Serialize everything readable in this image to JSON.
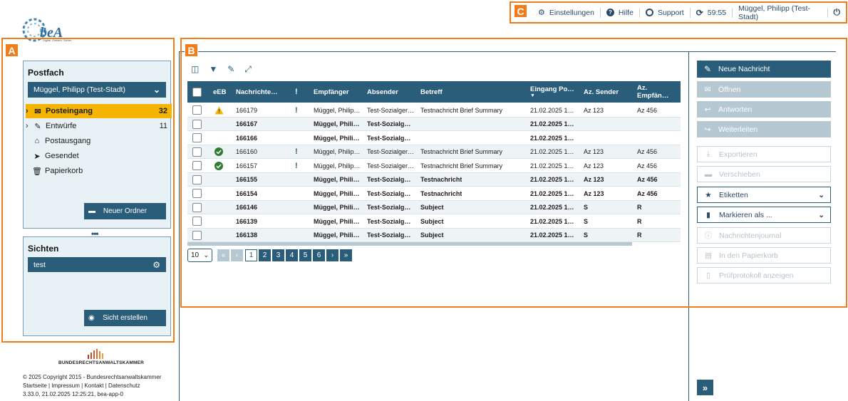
{
  "logo": {
    "text": "beA",
    "subtitle": "Digital. Einfach. Sicher."
  },
  "topbar": {
    "settings": "Einstellungen",
    "help": "Hilfe",
    "support": "Support",
    "timer": "59:55",
    "user": "Müggel, Philipp (Test-Stadt)"
  },
  "markers": {
    "a": "A",
    "b": "B",
    "c": "C"
  },
  "postfach": {
    "title": "Postfach",
    "selected": "Müggel, Philipp (Test-Stadt)",
    "folders": [
      {
        "label": "Posteingang",
        "count": "32"
      },
      {
        "label": "Entwürfe",
        "count": "11"
      },
      {
        "label": "Postausgang",
        "count": ""
      },
      {
        "label": "Gesendet",
        "count": ""
      },
      {
        "label": "Papierkorb",
        "count": ""
      }
    ],
    "new_folder": "Neuer Ordner"
  },
  "sichten": {
    "title": "Sichten",
    "item": "test",
    "create": "Sicht erstellen"
  },
  "footer": {
    "org": "BUNDESRECHTSANWALTSKAMMER",
    "copyright": "© 2025 Copyright 2015 - Bundesrechtsanwaltskammer",
    "links": "Startseite | Impressum | Kontakt | Datenschutz",
    "version": "3.33.0, 21.02.2025 12:25:21, bea-app-0"
  },
  "table": {
    "headers": {
      "eeb": "eEB",
      "nr": "Nachrichte…",
      "prio": "!",
      "recipient": "Empfänger",
      "sender": "Absender",
      "subject": "Betreff",
      "received": "Eingang Po…",
      "az_sender": "Az. Sender",
      "az_recipient": "Az. Empfän…"
    },
    "rows": [
      {
        "id": "166179",
        "status": "warn",
        "prio": "!",
        "recipient": "Müggel, Philip…",
        "sender": "Test-Sozialger…",
        "subject": "Testnachricht Brief Summary",
        "received": "21.02.2025 1…",
        "az_sender": "Az 123",
        "az_recipient": "Az 456",
        "bold": false
      },
      {
        "id": "166167",
        "status": "",
        "prio": "",
        "recipient": "Müggel, Phili…",
        "sender": "Test-Sozialg…",
        "subject": "",
        "received": "21.02.2025 1…",
        "az_sender": "",
        "az_recipient": "",
        "bold": true
      },
      {
        "id": "166166",
        "status": "",
        "prio": "",
        "recipient": "Müggel, Phili…",
        "sender": "Test-Sozialg…",
        "subject": "",
        "received": "21.02.2025 1…",
        "az_sender": "",
        "az_recipient": "",
        "bold": true
      },
      {
        "id": "166160",
        "status": "ok",
        "prio": "!",
        "recipient": "Müggel, Philip…",
        "sender": "Test-Sozialger…",
        "subject": "Testnachricht Brief Summary",
        "received": "21.02.2025 1…",
        "az_sender": "Az 123",
        "az_recipient": "Az 456",
        "bold": false
      },
      {
        "id": "166157",
        "status": "ok",
        "prio": "!",
        "recipient": "Müggel, Philip…",
        "sender": "Test-Sozialger…",
        "subject": "Testnachricht Brief Summary",
        "received": "21.02.2025 1…",
        "az_sender": "Az 123",
        "az_recipient": "Az 456",
        "bold": false
      },
      {
        "id": "166155",
        "status": "",
        "prio": "",
        "recipient": "Müggel, Phili…",
        "sender": "Test-Sozialg…",
        "subject": "Testnachricht",
        "received": "21.02.2025 1…",
        "az_sender": "Az 123",
        "az_recipient": "Az 456",
        "bold": true
      },
      {
        "id": "166154",
        "status": "",
        "prio": "",
        "recipient": "Müggel, Phili…",
        "sender": "Test-Sozialg…",
        "subject": "Testnachricht",
        "received": "21.02.2025 1…",
        "az_sender": "Az 123",
        "az_recipient": "Az 456",
        "bold": true
      },
      {
        "id": "166146",
        "status": "",
        "prio": "",
        "recipient": "Müggel, Phili…",
        "sender": "Test-Sozialg…",
        "subject": "Subject",
        "received": "21.02.2025 1…",
        "az_sender": "S",
        "az_recipient": "R",
        "bold": true
      },
      {
        "id": "166139",
        "status": "",
        "prio": "",
        "recipient": "Müggel, Phili…",
        "sender": "Test-Sozialg…",
        "subject": "Subject",
        "received": "21.02.2025 1…",
        "az_sender": "S",
        "az_recipient": "R",
        "bold": true
      },
      {
        "id": "166138",
        "status": "",
        "prio": "",
        "recipient": "Müggel, Phili…",
        "sender": "Test-Sozialg…",
        "subject": "Subject",
        "received": "21.02.2025 1…",
        "az_sender": "S",
        "az_recipient": "R",
        "bold": true
      }
    ]
  },
  "pagination": {
    "page_size": "10",
    "pages": [
      "1",
      "2",
      "3",
      "4",
      "5",
      "6"
    ],
    "current": "1"
  },
  "actions": {
    "new_message": "Neue Nachricht",
    "open": "Öffnen",
    "reply": "Antworten",
    "forward": "Weiterleiten",
    "export": "Exportieren",
    "move": "Verschieben",
    "labels": "Etiketten",
    "mark_as": "Markieren als ...",
    "journal": "Nachrichtenjournal",
    "trash": "In den Papierkorb",
    "report": "Prüfprotokoll anzeigen"
  },
  "colors": {
    "primary": "#2a5d7a",
    "accent": "#f07d1a",
    "inbox_highlight": "#f5b400",
    "disabled": "#b6c9d3",
    "ok": "#2e7d32",
    "warn": "#f5b400"
  }
}
